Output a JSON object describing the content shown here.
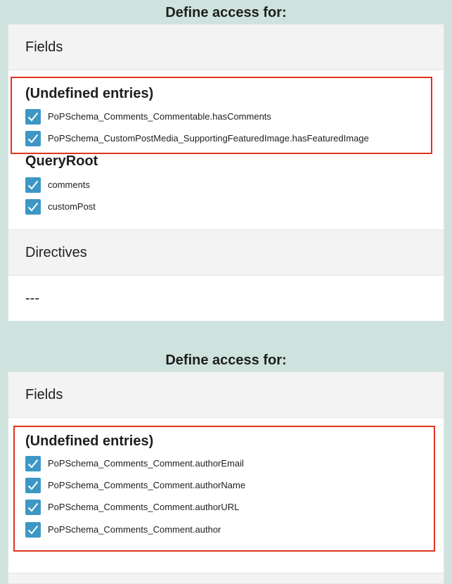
{
  "blocks": [
    {
      "title": "Define access for:",
      "fields_header": "Fields",
      "groups": [
        {
          "name": "(Undefined entries)",
          "items": [
            "PoPSchema_Comments_Commentable.hasComments",
            "PoPSchema_CustomPostMedia_SupportingFeaturedImage.hasFeaturedImage"
          ]
        },
        {
          "name": "QueryRoot",
          "items": [
            "comments",
            "customPost"
          ]
        }
      ],
      "directives_header": "Directives",
      "directives_value": "---"
    },
    {
      "title": "Define access for:",
      "fields_header": "Fields",
      "groups": [
        {
          "name": "(Undefined entries)",
          "items": [
            "PoPSchema_Comments_Comment.authorEmail",
            "PoPSchema_Comments_Comment.authorName",
            "PoPSchema_Comments_Comment.authorURL",
            "PoPSchema_Comments_Comment.author"
          ]
        }
      ]
    }
  ],
  "icons": {
    "checkbox": "checkmark-icon"
  },
  "colors": {
    "checkbox": "#3d97c5",
    "highlight": "#e0331f",
    "background": "#cfe3de"
  }
}
